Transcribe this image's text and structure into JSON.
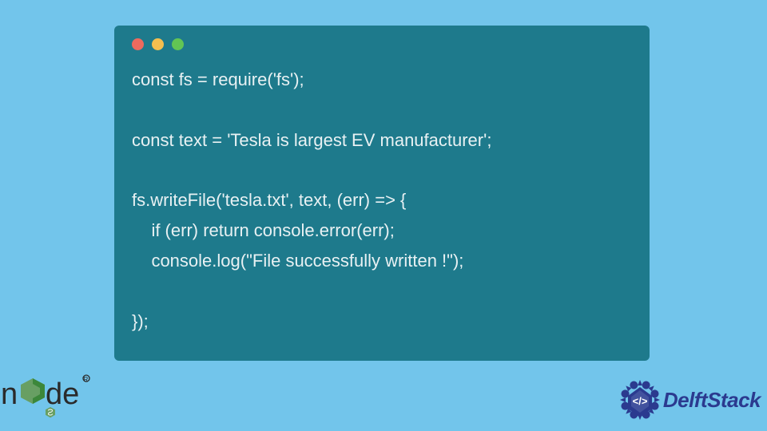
{
  "code": {
    "line1": "const fs = require('fs');",
    "line2": "",
    "line3": "const text = 'Tesla is largest EV manufacturer';",
    "line4": "",
    "line5": "fs.writeFile('tesla.txt', text, (err) => {",
    "line6": "    if (err) return console.error(err);",
    "line7": "    console.log(\"File successfully written !\");",
    "line8": "",
    "line9": "});"
  },
  "branding": {
    "delft_label": "DelftStack",
    "node_label": "node"
  },
  "colors": {
    "background": "#72c5eb",
    "window": "#1e7a8c",
    "text": "#e8f1f3",
    "node_green": "#3c873a",
    "delft_blue": "#2b3a8f"
  }
}
